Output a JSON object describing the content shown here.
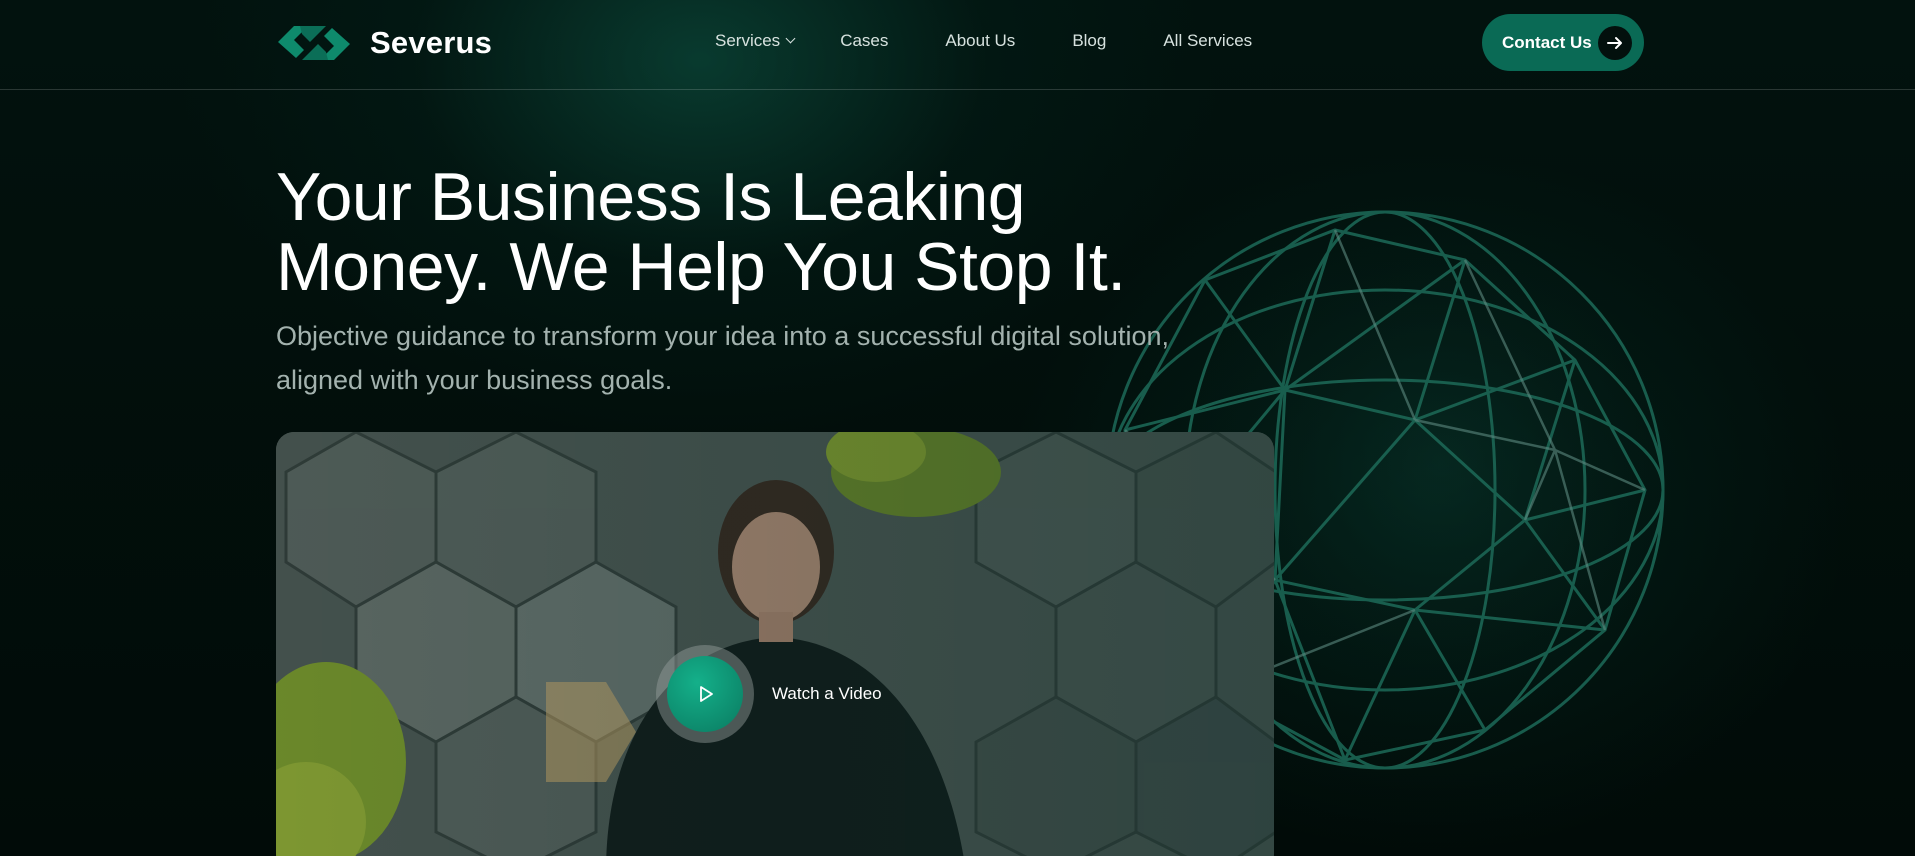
{
  "brand": {
    "name": "Severus",
    "accent": "#0a6a55",
    "logo_color": "#0e8a6c"
  },
  "nav": {
    "items": [
      {
        "label": "Services",
        "has_dropdown": true
      },
      {
        "label": "Cases"
      },
      {
        "label": "About Us"
      },
      {
        "label": "Blog"
      },
      {
        "label": "All Services"
      }
    ],
    "contact_label": "Contact Us",
    "contact_icon": "arrow-right-icon"
  },
  "hero": {
    "title_line1": "Your Business Is Leaking",
    "title_line2": "Money. We Help You Stop It.",
    "subtitle_line1": "Objective guidance to transform your idea into a successful digital solution,",
    "subtitle_line2": "aligned with your business goals."
  },
  "video": {
    "play_icon": "play-icon",
    "label": "Watch a Video"
  },
  "colors": {
    "background": "#010d0a",
    "text": "#ffffff",
    "muted_text": "#a3b2ae",
    "nav_text": "#d7e2df"
  }
}
